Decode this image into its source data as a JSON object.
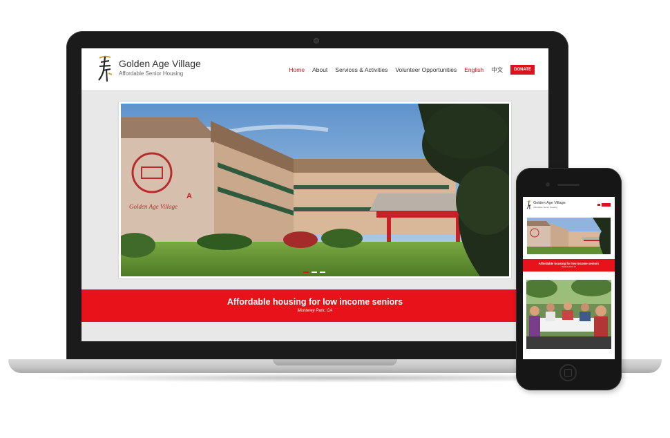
{
  "site": {
    "name": "Golden Age Village",
    "tagline": "Affordable Senior Housing"
  },
  "nav": {
    "home": "Home",
    "about": "About",
    "services": "Services & Activities",
    "volunteer": "Volunteer Opportunities",
    "english": "English",
    "chinese": "中文",
    "donate": "DONATE"
  },
  "slider": {
    "slide_count": 3,
    "active_slide": 1
  },
  "banner": {
    "title": "Affordable housing for low income seniors",
    "location": "Monterey Park, CA"
  },
  "mobile": {
    "site_name": "Golden Age Village",
    "tagline": "Affordable Senior Housing",
    "banner_title": "Affordable housing for low income seniors",
    "banner_location": "Monterey Park, CA"
  },
  "colors": {
    "brand_red": "#e8121a",
    "device_body": "#1b1b1b",
    "page_bg": "#e8e8e8"
  }
}
